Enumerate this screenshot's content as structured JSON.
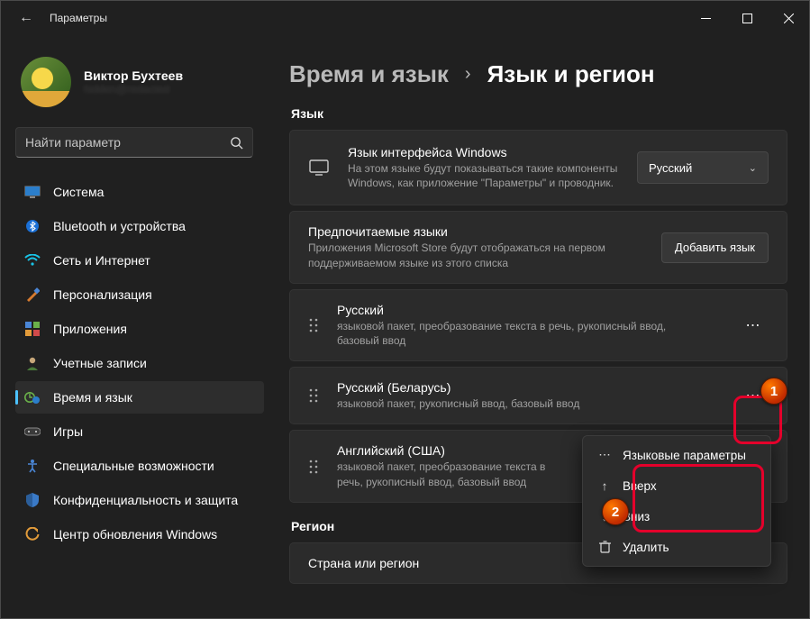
{
  "window": {
    "title": "Параметры"
  },
  "profile": {
    "name": "Виктор Бухтеев",
    "email_masked": "hidden@redacted"
  },
  "search": {
    "placeholder": "Найти параметр"
  },
  "nav": {
    "items": [
      {
        "label": "Система",
        "icon": "display"
      },
      {
        "label": "Bluetooth и устройства",
        "icon": "bluetooth"
      },
      {
        "label": "Сеть и Интернет",
        "icon": "wifi"
      },
      {
        "label": "Персонализация",
        "icon": "brush"
      },
      {
        "label": "Приложения",
        "icon": "apps"
      },
      {
        "label": "Учетные записи",
        "icon": "user"
      },
      {
        "label": "Время и язык",
        "icon": "time-lang",
        "active": true
      },
      {
        "label": "Игры",
        "icon": "games"
      },
      {
        "label": "Специальные возможности",
        "icon": "accessibility"
      },
      {
        "label": "Конфиденциальность и защита",
        "icon": "shield"
      },
      {
        "label": "Центр обновления Windows",
        "icon": "update"
      }
    ]
  },
  "breadcrumb": {
    "root": "Время и язык",
    "leaf": "Язык и регион"
  },
  "lang_section": {
    "header": "Язык",
    "ui_lang": {
      "title": "Язык интерфейса Windows",
      "desc": "На этом языке будут показываться такие компоненты Windows, как приложение \"Параметры\" и проводник.",
      "selected": "Русский"
    },
    "preferred": {
      "title": "Предпочитаемые языки",
      "desc": "Приложения Microsoft Store будут отображаться на первом поддерживаемом языке из этого списка",
      "add_label": "Добавить язык"
    },
    "languages": [
      {
        "name": "Русский",
        "feat": "языковой пакет, преобразование текста в речь, рукописный ввод, базовый ввод"
      },
      {
        "name": "Русский (Беларусь)",
        "feat": "языковой пакет, рукописный ввод, базовый ввод"
      },
      {
        "name": "Английский (США)",
        "feat": "языковой пакет, преобразование текста в речь, рукописный ввод, базовый ввод"
      }
    ]
  },
  "region_section": {
    "header": "Регион",
    "row_title": "Страна или регион"
  },
  "context_menu": {
    "items": [
      {
        "label": "Языковые параметры",
        "icon": "more"
      },
      {
        "label": "Вверх",
        "icon": "up"
      },
      {
        "label": "Вниз",
        "icon": "down"
      },
      {
        "label": "Удалить",
        "icon": "trash"
      }
    ]
  },
  "annotations": {
    "one": "1",
    "two": "2"
  }
}
